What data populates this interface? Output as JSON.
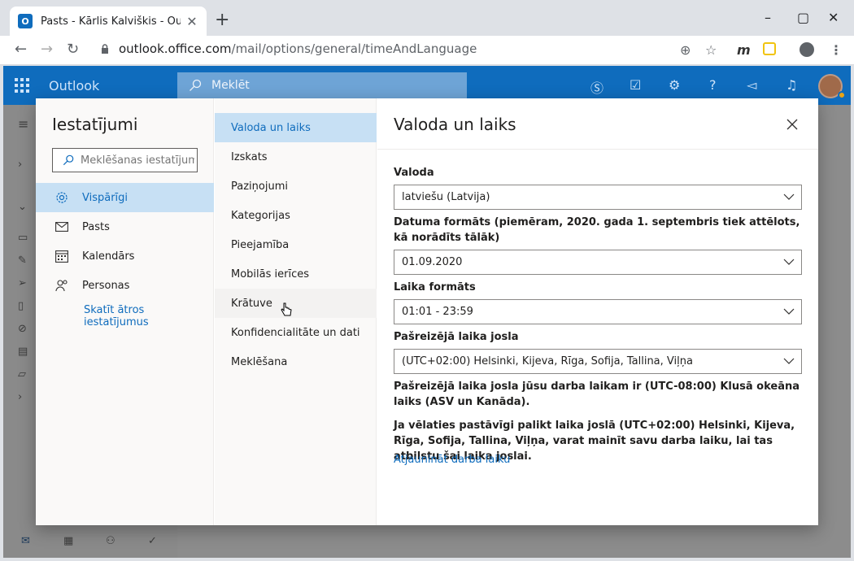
{
  "browser": {
    "tab_title": "Pasts - Kārlis Kalviškis - Outlook",
    "tab_favicon": "O",
    "url_host": "outlook.office.com",
    "url_path": "/mail/options/general/timeAndLanguage"
  },
  "outlook": {
    "brand": "Outlook",
    "search_placeholder": "Meklēt"
  },
  "settings": {
    "title": "Iestatījumi",
    "search_placeholder": "Meklēšanas iestatījumi",
    "categories": [
      {
        "label": "Vispārīgi",
        "icon": "gear-icon"
      },
      {
        "label": "Pasts",
        "icon": "mail-icon"
      },
      {
        "label": "Kalendārs",
        "icon": "calendar-icon"
      },
      {
        "label": "Personas",
        "icon": "people-icon"
      }
    ],
    "quick_link": "Skatīt ātros iestatījumus",
    "subcategories": [
      "Valoda un laiks",
      "Izskats",
      "Paziņojumi",
      "Kategorijas",
      "Pieejamība",
      "Mobilās ierīces",
      "Krātuve",
      "Konfidencialitāte un dati",
      "Meklēšana"
    ]
  },
  "pane": {
    "title": "Valoda un laiks",
    "language_label": "Valoda",
    "language_value": "latviešu (Latvija)",
    "date_format_label": "Datuma formāts (piemēram, 2020. gada 1. septembris tiek attēlots, kā norādīts tālāk)",
    "date_format_value": "01.09.2020",
    "time_format_label": "Laika formāts",
    "time_format_value": "01:01 - 23:59",
    "timezone_label": "Pašreizējā laika josla",
    "timezone_value": "(UTC+02:00) Helsinki, Kijeva, Rīga, Sofija, Tallina, Viļņa",
    "info1": "Pašreizējā laika josla jūsu darba laikam ir (UTC-08:00) Klusā okeāna laiks (ASV un Kanāda).",
    "info2": "Ja vēlaties pastāvīgi palikt laika joslā (UTC+02:00) Helsinki, Kijeva, Rīga, Sofija, Tallina, Viļņa, varat mainīt savu darba laiku, lai tas atbilstu šai laika joslai.",
    "update_link": "Atjaunināt darba laiku"
  }
}
